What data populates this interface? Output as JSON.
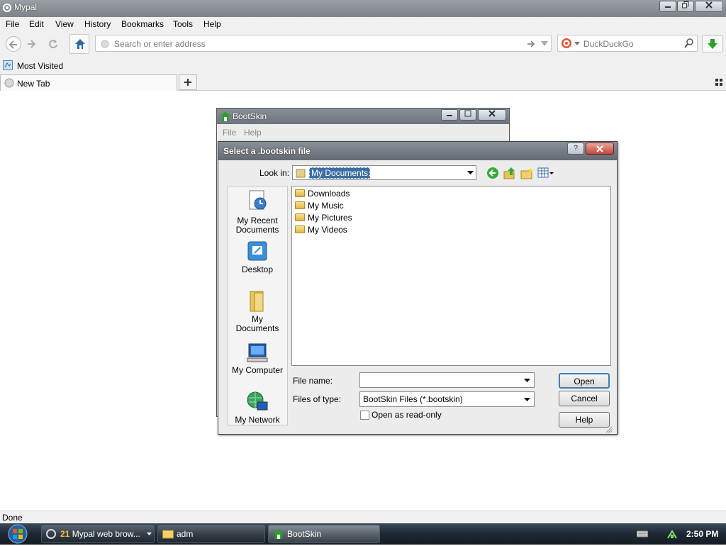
{
  "window": {
    "title": "Mypal"
  },
  "menu": [
    "File",
    "Edit",
    "View",
    "History",
    "Bookmarks",
    "Tools",
    "Help"
  ],
  "nav": {
    "address_placeholder": "Search or enter address",
    "search_engine": "DuckDuckGo"
  },
  "bookmarks": {
    "most_visited": "Most Visited"
  },
  "tabs": [
    {
      "label": "New Tab"
    }
  ],
  "status": "Done",
  "bootskin": {
    "title": "BootSkin",
    "menu": [
      "File",
      "Help"
    ]
  },
  "dialog": {
    "title": "Select a .bootskin file",
    "look_in_label": "Look in:",
    "look_in_value": "My Documents",
    "places": [
      "My Recent Documents",
      "Desktop",
      "My Documents",
      "My Computer",
      "My Network"
    ],
    "files": [
      "Downloads",
      "My Music",
      "My Pictures",
      "My Videos"
    ],
    "file_name_label": "File name:",
    "file_name_value": "",
    "files_of_type_label": "Files of type:",
    "files_of_type_value": "BootSkin Files (*.bootskin)",
    "read_only_label": "Open as read-only",
    "open_button": "Open",
    "cancel_button": "Cancel",
    "help_button": "Help"
  },
  "taskbar": {
    "items": [
      {
        "count": "21",
        "label": "Mypal web brow..."
      },
      {
        "label": "adm"
      },
      {
        "label": "BootSkin"
      }
    ],
    "clock": "2:50 PM"
  },
  "colors": {
    "titlebar": "#7d8389",
    "taskbar": "#1d2833",
    "default_button_border": "#3c7fb1"
  }
}
